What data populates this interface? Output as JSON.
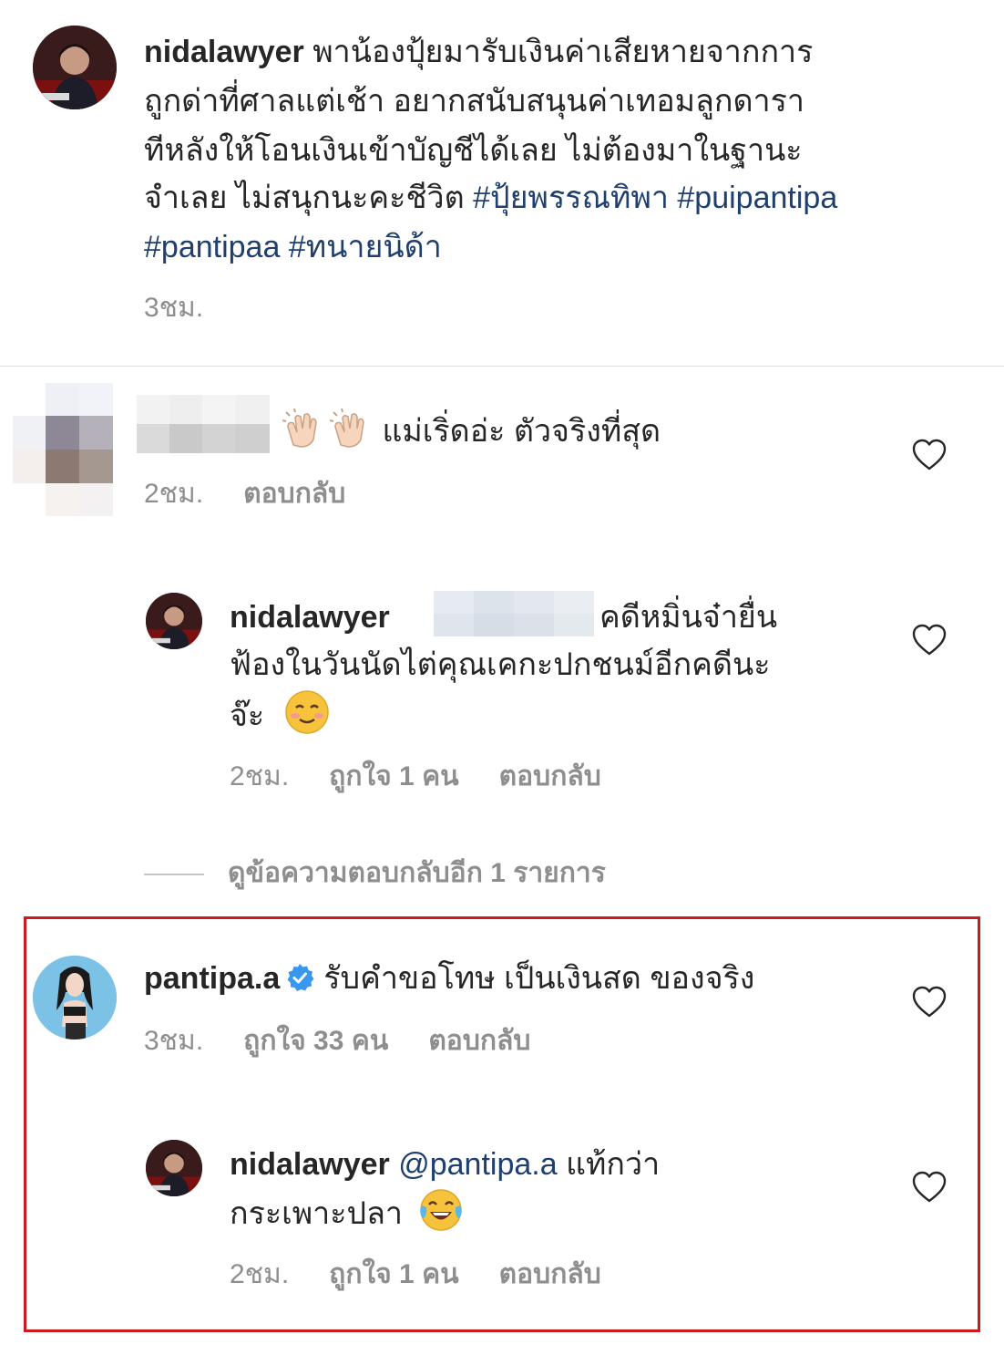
{
  "caption": {
    "username": "nidalawyer",
    "line1_text": "พาน้องปุ้ยมารับเงินค่าเสียหายจากการ",
    "line2": "ถูกด่าที่ศาลแต่เช้า อยากสนับสนุนค่าเทอมลูกดารา",
    "line3": "ทีหลังให้โอนเงินเข้าบัญชีได้เลย ไม่ต้องมาในฐานะ",
    "line4_text": "จำเลย ไม่สนุกนะคะชีวิต",
    "hashtags_line4": "#ปุ้ยพรรณทิพา #puipantipa",
    "hashtags_line5": "#pantipaa #ทนายนิด้า",
    "time": "3ชม."
  },
  "comments": [
    {
      "username_hidden": true,
      "text": "แม่เริ่ดอ่ะ ตัวจริงที่สุด",
      "emoji": [
        "clapping-hands",
        "clapping-hands"
      ],
      "time": "2ชม.",
      "reply": "ตอบกลับ"
    },
    {
      "username": "nidalawyer",
      "mention_hidden": true,
      "line1_text": "คดีหมิ่นจ๋ายื่น",
      "line2": "ฟ้องในวันนัดไต่คุณเคกะปกชนม์อีกคดีนะ",
      "line3": "จ๊ะ",
      "emoji": "smiling-face",
      "time": "2ชม.",
      "likes": "ถูกใจ 1 คน",
      "reply": "ตอบกลับ"
    }
  ],
  "view_replies": "ดูข้อความตอบกลับอีก 1 รายการ",
  "highlighted": [
    {
      "username": "pantipa.a",
      "verified": true,
      "text": "รับคำขอโทษ เป็นเงินสด ของจริง",
      "time": "3ชม.",
      "likes": "ถูกใจ 33 คน",
      "reply": "ตอบกลับ"
    },
    {
      "username": "nidalawyer",
      "mention": "@pantipa.a",
      "line1_text": "แท้กว่า",
      "line2": "กระเพาะปลา",
      "emoji": "face-with-tears-of-joy",
      "time": "2ชม.",
      "likes": "ถูกใจ 1 คน",
      "reply": "ตอบกลับ"
    }
  ],
  "colors": {
    "hashtag": "#1f3f6f",
    "meta": "#8e8e8e",
    "highlight_border": "#d0191b",
    "verified": "#3897f0"
  }
}
